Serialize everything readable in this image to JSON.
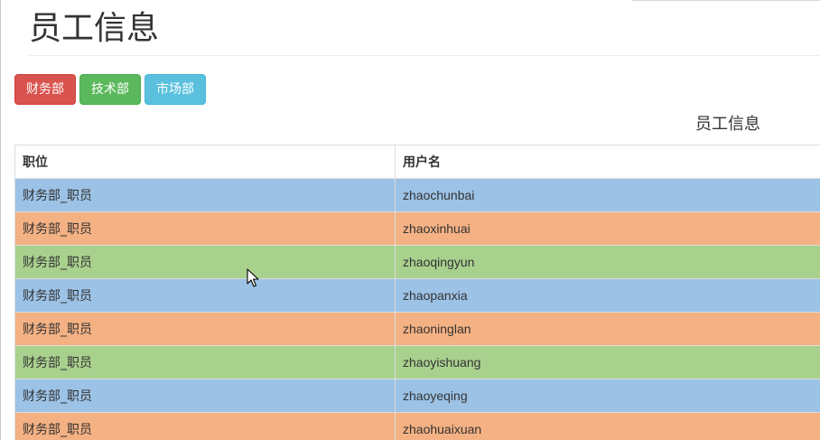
{
  "page": {
    "title": "员工信息"
  },
  "departments": {
    "finance_label": "财务部",
    "tech_label": "技术部",
    "market_label": "市场部",
    "colors": {
      "finance": "#d9534f",
      "tech": "#5cb85c",
      "market": "#5bc0de"
    }
  },
  "table": {
    "caption": "员工信息",
    "headers": [
      "职位",
      "用户名"
    ],
    "row_colors": [
      "#9cc2e6",
      "#f4b183",
      "#a9d18e"
    ],
    "rows": [
      {
        "position": "财务部_职员",
        "username": "zhaochunbai"
      },
      {
        "position": "财务部_职员",
        "username": "zhaoxinhuai"
      },
      {
        "position": "财务部_职员",
        "username": "zhaoqingyun"
      },
      {
        "position": "财务部_职员",
        "username": "zhaopanxia"
      },
      {
        "position": "财务部_职员",
        "username": "zhaoninglan"
      },
      {
        "position": "财务部_职员",
        "username": "zhaoyishuang"
      },
      {
        "position": "财务部_职员",
        "username": "zhaoyeqing"
      },
      {
        "position": "财务部_职员",
        "username": "zhaohuaixuan"
      }
    ]
  }
}
